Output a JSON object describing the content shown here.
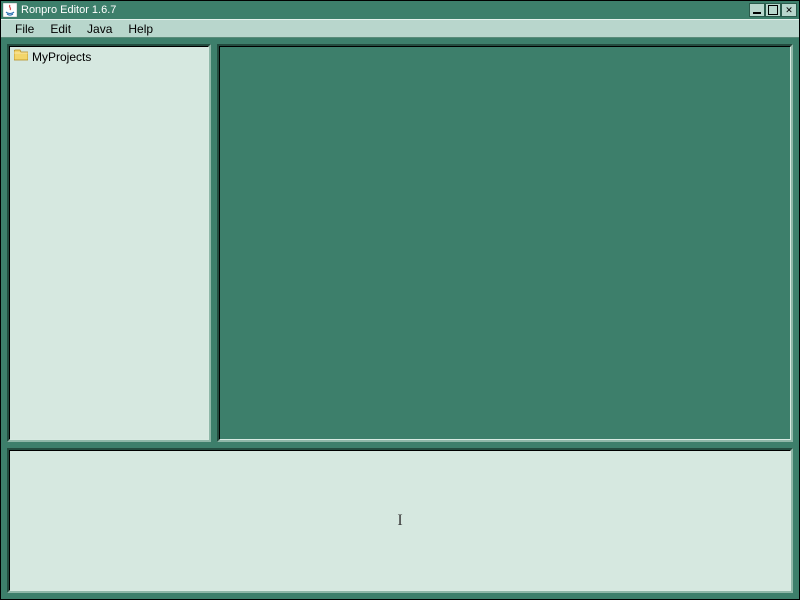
{
  "window": {
    "title": "Ronpro Editor 1.6.7"
  },
  "menubar": {
    "items": [
      "File",
      "Edit",
      "Java",
      "Help"
    ]
  },
  "tree": {
    "root_label": "MyProjects"
  },
  "console": {
    "caret_glyph": "I"
  },
  "colors": {
    "frame": "#3d7f6b",
    "panel_light": "#d6e8e0",
    "menu_bg": "#b8d6cc"
  }
}
